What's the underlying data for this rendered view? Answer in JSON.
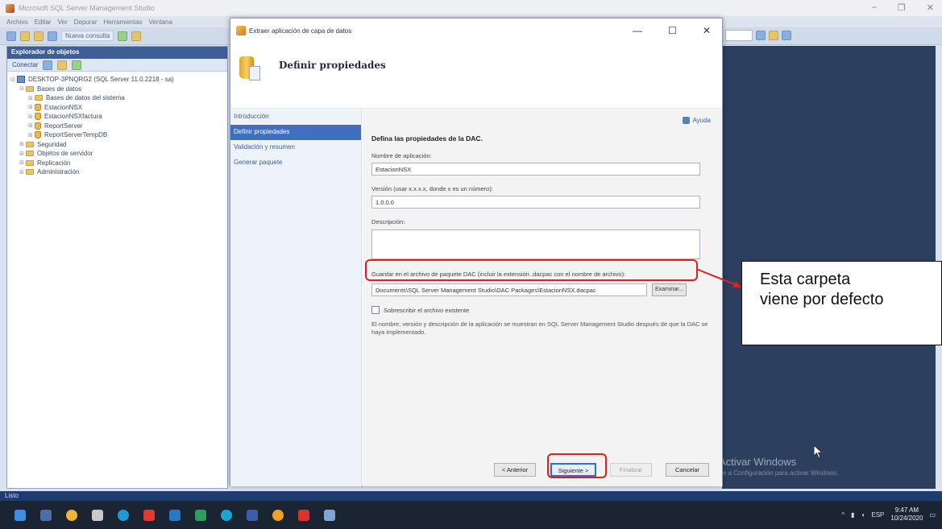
{
  "ssms": {
    "title": "Microsoft SQL Server Management Studio",
    "menu": [
      "Archivo",
      "Editar",
      "Ver",
      "Depurar",
      "Herramientas",
      "Ventana"
    ],
    "new_query_label": "Nueva consulta",
    "status": "Listo",
    "explorer": {
      "title": "Explorador de objetos",
      "connect_label": "Conectar",
      "tree": [
        {
          "label": "DESKTOP-3PNQRG2 (SQL Server 11.0.2218 - sa)",
          "icon": "server",
          "indent": 0,
          "exp": "⊟"
        },
        {
          "label": "Bases de datos",
          "icon": "folder",
          "indent": 1,
          "exp": "⊟"
        },
        {
          "label": "Bases de datos del sistema",
          "icon": "folder",
          "indent": 2,
          "exp": "⊞"
        },
        {
          "label": "EstacionNSX",
          "icon": "db",
          "indent": 2,
          "exp": "⊞"
        },
        {
          "label": "EstacionNSXfactura",
          "icon": "db",
          "indent": 2,
          "exp": "⊞"
        },
        {
          "label": "ReportServer",
          "icon": "db",
          "indent": 2,
          "exp": "⊞"
        },
        {
          "label": "ReportServerTempDB",
          "icon": "db",
          "indent": 2,
          "exp": "⊞"
        },
        {
          "label": "Seguridad",
          "icon": "folder",
          "indent": 1,
          "exp": "⊞"
        },
        {
          "label": "Objetos de servidor",
          "icon": "folder",
          "indent": 1,
          "exp": "⊞"
        },
        {
          "label": "Replicación",
          "icon": "folder",
          "indent": 1,
          "exp": "⊞"
        },
        {
          "label": "Administración",
          "icon": "folder",
          "indent": 1,
          "exp": "⊞"
        }
      ]
    },
    "activate": {
      "line1": "Activar Windows",
      "line2": "Ve a Configuración para activar Windows."
    }
  },
  "dialog": {
    "title": "Extraer aplicación de capa de datos",
    "header_title": "Definir propiedades",
    "nav": [
      {
        "label": "Introducción",
        "active": false
      },
      {
        "label": "Definir propiedades",
        "active": true
      },
      {
        "label": "Validación y resumen",
        "active": false
      },
      {
        "label": "Generar paquete",
        "active": false
      }
    ],
    "help_label": "Ayuda",
    "section_title": "Defina las propiedades de la DAC.",
    "app_name_label": "Nombre de aplicación:",
    "app_name_value": "EstacionNSX",
    "version_label": "Versión (usar x.x.x.x, donde x es un número):",
    "version_value": "1.0.0.0",
    "description_label": "Descripción:",
    "description_value": "",
    "save_label": "Guardar en el archivo de paquete DAC (incluir la extensión .dacpac con el nombre de archivo):",
    "save_path": "Documents\\SQL Server Management Studio\\DAC Packages\\EstacionNSX.dacpac",
    "browse_label": "Examinar...",
    "overwrite_label": "Sobrescribir el archivo existente",
    "info_text": "El nombre, versión y descripción de la aplicación se muestran en SQL Server Management Studio después de que la DAC se haya implementado.",
    "buttons": {
      "back": "< Anterior",
      "next": "Siguiente >",
      "finish": "Finalizar",
      "cancel": "Cancelar"
    }
  },
  "annotation": {
    "callout_line1": "Esta carpeta",
    "callout_line2": "viene por defecto",
    "color": "#e02020"
  },
  "taskbar": {
    "time": "9:47 AM",
    "date": "10/24/2020",
    "lang": "ESP"
  }
}
